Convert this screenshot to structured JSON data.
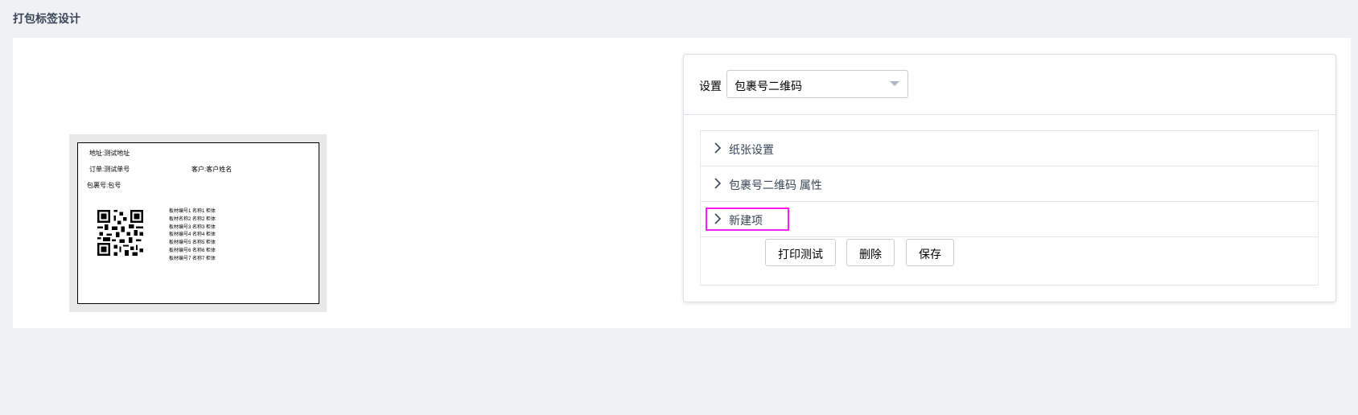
{
  "page": {
    "title": "打包标签设计"
  },
  "label": {
    "address": "地址:测试地址",
    "order": "订单:测试单号",
    "customer": "客户:客户姓名",
    "package": "包裹号:包号",
    "items": [
      "板材编号1 名称1 柜体",
      "板材名称2 名称2 柜体",
      "板材编号3 名称3 柜体",
      "板材编号4 名称4 柜体",
      "板材编号5 名称5 柜体",
      "板材编号6 名称6 柜体",
      "板材编号7 名称7 柜体"
    ]
  },
  "settings": {
    "label": "设置",
    "select_value": "包裹号二维码",
    "panels": [
      {
        "label": "纸张设置"
      },
      {
        "label": "包裹号二维码 属性"
      },
      {
        "label": "新建项"
      }
    ],
    "buttons": {
      "print_test": "打印测试",
      "delete": "删除",
      "save": "保存"
    }
  },
  "colors": {
    "highlight": "#ff1cf0",
    "background": "#f0f1f5",
    "title": "#3a4556"
  },
  "icons": {
    "panel_toggle": "chevron-right-icon",
    "select_toggle": "caret-down-icon"
  }
}
